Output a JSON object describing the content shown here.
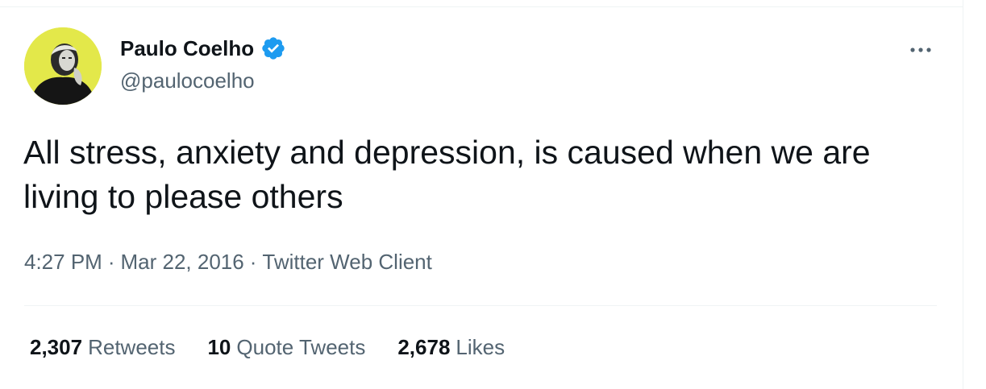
{
  "author": {
    "name": "Paulo Coelho",
    "handle": "@paulocoelho",
    "verified_icon": "verified-badge-icon",
    "avatar_bg": "#e3e84a"
  },
  "tweet": {
    "text": "All stress, anxiety and depression, is caused when we are living to please others"
  },
  "meta": {
    "time": "4:27 PM",
    "separator": "·",
    "date": "Mar 22, 2016",
    "source": "Twitter Web Client"
  },
  "stats": {
    "retweets": {
      "count": "2,307",
      "label": "Retweets"
    },
    "quote_tweets": {
      "count": "10",
      "label": "Quote Tweets"
    },
    "likes": {
      "count": "2,678",
      "label": "Likes"
    }
  },
  "colors": {
    "text_primary": "#0f1419",
    "text_secondary": "#536471",
    "verified_blue": "#1d9bf0",
    "divider": "#eff3f4"
  },
  "icons": {
    "more": "more-horizontal-icon"
  }
}
